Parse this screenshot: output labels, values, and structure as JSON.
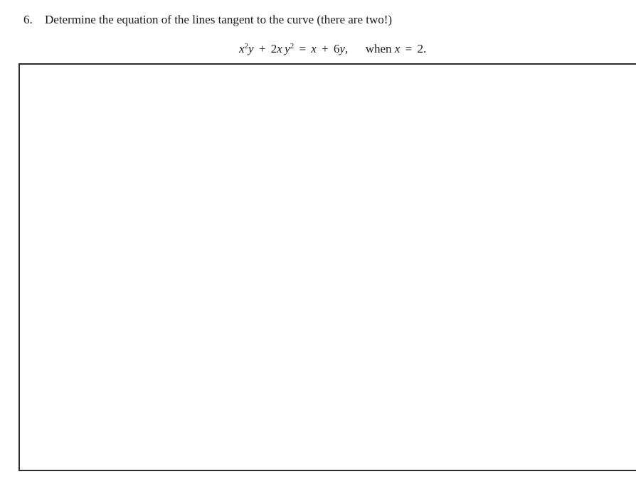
{
  "question": {
    "number": "6.",
    "prompt": "Determine the equation of the lines tangent to the curve (there are two!)"
  },
  "equation": {
    "lhs_term1_base": "x",
    "lhs_term1_exp": "2",
    "lhs_term1_var": "y",
    "plus1": "+",
    "lhs_term2_coef": "2",
    "lhs_term2_x": "x",
    "lhs_term2_y": "y",
    "lhs_term2_exp": "2",
    "equals": "=",
    "rhs_x": "x",
    "plus2": "+",
    "rhs_coef": "6",
    "rhs_y": "y",
    "comma": ",",
    "condition_word": "when",
    "condition_var": "x",
    "condition_equals": "=",
    "condition_value": "2."
  },
  "answer_box": {
    "content": ""
  }
}
